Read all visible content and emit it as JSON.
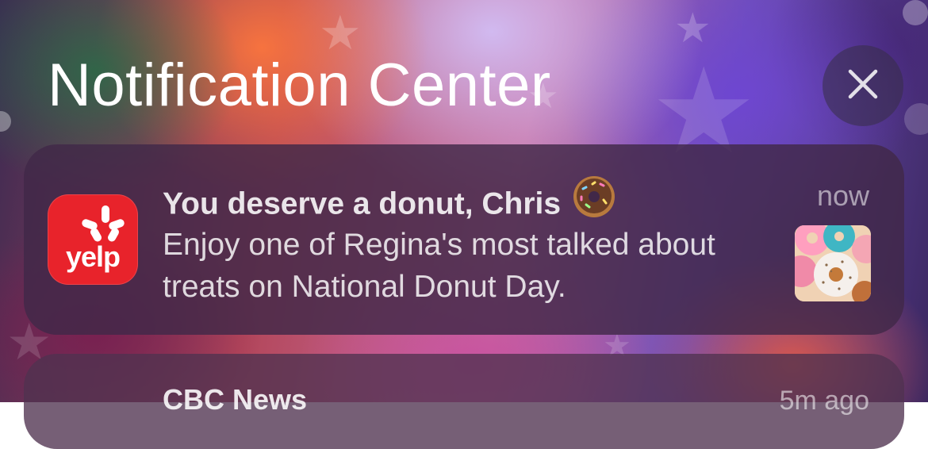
{
  "header": {
    "title": "Notification Center"
  },
  "notifications": [
    {
      "app_icon": "yelp-icon",
      "app_icon_text": "yelp",
      "title": "You deserve a donut, Chris",
      "title_emoji": "donut-emoji",
      "body": "Enjoy one of Regina's most talked about treats on National Donut Day.",
      "time": "now",
      "attachment": "donut-thumbnail"
    },
    {
      "title": "CBC News",
      "time": "5m ago"
    }
  ],
  "colors": {
    "yelp_red": "#e8232b",
    "card_bg": "#412848"
  },
  "icons": {
    "close": "close-icon"
  }
}
